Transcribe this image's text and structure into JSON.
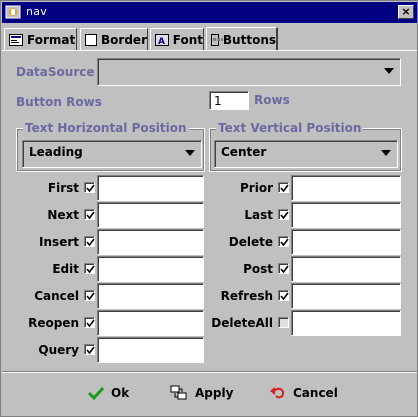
{
  "window": {
    "title": "nav"
  },
  "tabs": [
    {
      "label": "Format",
      "icon": "format-icon"
    },
    {
      "label": "Border",
      "icon": "border-icon"
    },
    {
      "label": "Font",
      "icon": "font-icon"
    },
    {
      "label": "Buttons",
      "icon": "buttons-icon"
    }
  ],
  "active_tab": "Buttons",
  "datasource": {
    "label": "DataSource",
    "value": ""
  },
  "button_rows": {
    "label": "Button Rows",
    "value": "1",
    "suffix": "Rows"
  },
  "horizontal": {
    "title": "Text Horizontal Position",
    "value": "Leading"
  },
  "vertical": {
    "title": "Text Vertical Position",
    "value": "Center"
  },
  "left_buttons": [
    {
      "label": "First",
      "checked": true,
      "value": ""
    },
    {
      "label": "Next",
      "checked": true,
      "value": ""
    },
    {
      "label": "Insert",
      "checked": true,
      "value": ""
    },
    {
      "label": "Edit",
      "checked": true,
      "value": ""
    },
    {
      "label": "Cancel",
      "checked": true,
      "value": ""
    },
    {
      "label": "Reopen",
      "checked": true,
      "value": ""
    },
    {
      "label": "Query",
      "checked": true,
      "value": ""
    }
  ],
  "right_buttons": [
    {
      "label": "Prior",
      "checked": true,
      "value": ""
    },
    {
      "label": "Last",
      "checked": true,
      "value": ""
    },
    {
      "label": "Delete",
      "checked": true,
      "value": ""
    },
    {
      "label": "Post",
      "checked": true,
      "value": ""
    },
    {
      "label": "Refresh",
      "checked": true,
      "value": ""
    },
    {
      "label": "DeleteAll",
      "checked": false,
      "value": ""
    }
  ],
  "footer": {
    "ok": "Ok",
    "apply": "Apply",
    "cancel": "Cancel"
  },
  "colors": {
    "titlebar": "#000080",
    "label_accent": "#6a6aa0",
    "ok_green": "#1a9a1a",
    "cancel_red": "#d02020"
  }
}
